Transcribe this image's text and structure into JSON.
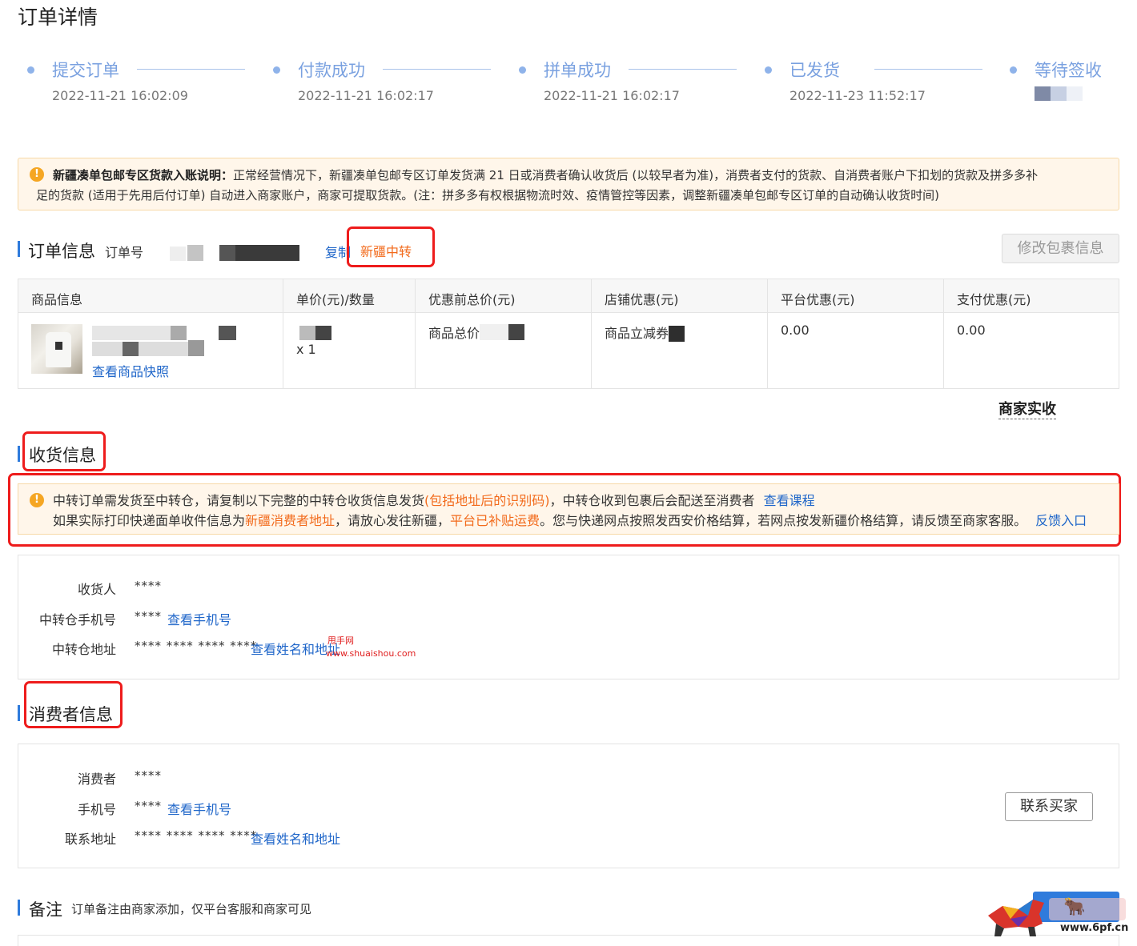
{
  "page_title": "订单详情",
  "steps": [
    {
      "label": "提交订单",
      "time": "2022-11-21 16:02:09"
    },
    {
      "label": "付款成功",
      "time": "2022-11-21 16:02:17"
    },
    {
      "label": "拼单成功",
      "time": "2022-11-21 16:02:17"
    },
    {
      "label": "已发货",
      "time": "2022-11-23 11:52:17"
    },
    {
      "label": "等待签收",
      "time": ""
    }
  ],
  "notice": {
    "title": "新疆凑单包邮专区货款入账说明：",
    "line1": "正常经营情况下，新疆凑单包邮专区订单发货满 21 日或消费者确认收货后 (以较早者为准)，消费者支付的货款、自消费者账户下扣划的货款及拼多多补",
    "line2": "足的货款 (适用于先用后付订单) 自动进入商家账户，商家可提取货款。(注：拼多多有权根据物流时效、疫情管控等因素，调整新疆凑单包邮专区订单的自动确认收货时间)"
  },
  "order_info": {
    "title": "订单信息",
    "order_no_label": "订单号",
    "copy_label": "复制",
    "tag": "新疆中转",
    "modify_button": "修改包裹信息"
  },
  "table": {
    "headers": [
      "商品信息",
      "单价(元)/数量",
      "优惠前总价(元)",
      "店铺优惠(元)",
      "平台优惠(元)",
      "支付优惠(元)"
    ],
    "row": {
      "snapshot_link": "查看商品快照",
      "quantity": "x 1",
      "total_label": "商品总价",
      "shop_discount_label": "商品立减券",
      "platform_discount": "0.00",
      "pay_discount": "0.00"
    },
    "merchant_received_label": "商家实收"
  },
  "shipping": {
    "title": "收货信息",
    "note_part1": "中转订单需发货至中转仓，请复制以下完整的中转仓收货信息发货",
    "note_highlight1": "(包括地址后的识别码)",
    "note_part2": "，中转仓收到包裹后会配送至消费者",
    "note_link1": "查看课程",
    "note2_part1": "如果实际打印快递面单收件信息为",
    "note2_highlight1": "新疆消费者地址",
    "note2_part2": "，请放心发往新疆，",
    "note2_highlight2": "平台已补贴运费",
    "note2_part3": "。您与快递网点按照发西安价格结算，若网点按发新疆价格结算，请反馈至商家客服。",
    "note_link2": "反馈入口",
    "receiver_label": "收货人",
    "receiver_value": "****",
    "phone_label": "中转仓手机号",
    "phone_value": "****",
    "phone_link": "查看手机号",
    "address_label": "中转仓地址",
    "address_value": "**** **** **** ****",
    "address_link": "查看姓名和地址",
    "watermark_1": "甩手网",
    "watermark_2": "www.shuaishou.com"
  },
  "consumer": {
    "title": "消费者信息",
    "name_label": "消费者",
    "name_value": "****",
    "phone_label": "手机号",
    "phone_value": "****",
    "phone_link": "查看手机号",
    "address_label": "联系地址",
    "address_value": "**** **** **** ****",
    "address_link": "查看姓名和地址",
    "contact_button": "联系买家"
  },
  "remark": {
    "title": "备注",
    "desc": "订单备注由商家添加，仅平台客服和商家可见"
  },
  "logo_watermark": {
    "text": "www.6pf.cn"
  },
  "colors": {
    "accent_blue": "#1f66c9",
    "step_blue": "#7aa1e0",
    "orange": "#f26a1b",
    "highlight_red": "#ee1c1c",
    "notice_bg": "#fff6ea"
  }
}
